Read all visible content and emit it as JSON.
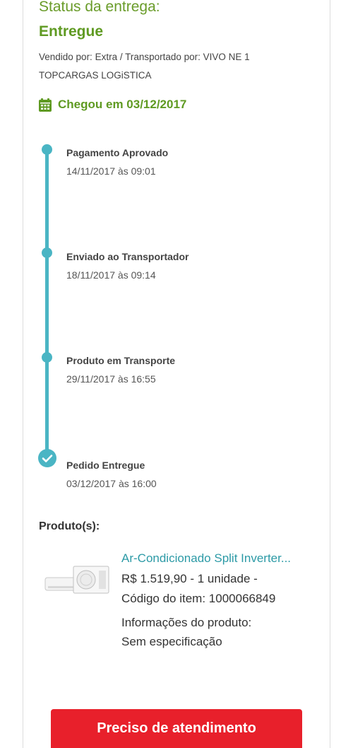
{
  "delivery": {
    "status_label": "Status da entrega:",
    "status_value": "Entregue",
    "seller_info": "Vendido por: Extra / Transportado por: VIVO NE 1 TOPCARGAS LOGiSTICA",
    "arrival": "Chegou em 03/12/2017"
  },
  "timeline": [
    {
      "title": "Pagamento Aprovado",
      "date": "14/11/2017 às 09:01"
    },
    {
      "title": "Enviado ao Transportador",
      "date": "18/11/2017 às 09:14"
    },
    {
      "title": "Produto em Transporte",
      "date": "29/11/2017 às 16:55"
    },
    {
      "title": "Pedido Entregue",
      "date": "03/12/2017 às 16:00"
    }
  ],
  "products": {
    "heading": "Produto(s):",
    "items": [
      {
        "name": "Ar-Condicionado Split Inverter...",
        "price_line": "R$ 1.519,90 - 1 unidade -",
        "code_line": "Código do item: 1000066849",
        "info_label": "Informações do produto:",
        "info_value": "Sem especificação"
      }
    ]
  },
  "actions": {
    "help_button": "Preciso de atendimento"
  },
  "colors": {
    "green": "#5f9a22",
    "timeline": "#4ab5c4",
    "link": "#2c9aa6",
    "button": "#e8202b"
  },
  "icons": {
    "calendar": "calendar-icon",
    "check": "check-icon"
  }
}
